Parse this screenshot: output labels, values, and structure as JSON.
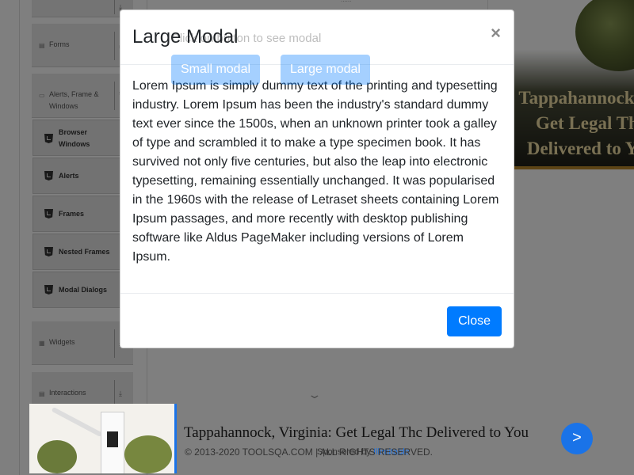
{
  "top_faint_text": "......",
  "sidebar": {
    "groups": [
      {
        "label": "Forms",
        "icon": "document-icon"
      },
      {
        "label_line1": "Alerts, Frame &",
        "label_line2": "Windows",
        "icon": "window-icon"
      },
      {
        "label": "Widgets",
        "icon": "grid-icon"
      },
      {
        "label": "Interactions",
        "icon": "document-icon"
      }
    ],
    "items": [
      {
        "label_line1": "Browser",
        "label_line2": "Windows"
      },
      {
        "label": "Alerts"
      },
      {
        "label": "Frames"
      },
      {
        "label": "Nested Frames"
      },
      {
        "label": "Modal Dialogs"
      }
    ]
  },
  "page": {
    "hint": "Click on button to see modal",
    "small_modal_label": "Small modal",
    "large_modal_label": "Large modal"
  },
  "modal": {
    "title": "Large Modal",
    "close_symbol": "×",
    "body": "Lorem Ipsum is simply dummy text of the printing and typesetting industry. Lorem Ipsum has been the industry's standard dummy text ever since the 1500s, when an unknown printer took a galley of type and scrambled it to make a type specimen book. It has survived not only five centuries, but also the leap into electronic typesetting, remaining essentially unchanged. It was popularised in the 1960s with the release of Letraset sheets containing Lorem Ipsum passages, and more recently with desktop publishing software like Aldus PageMaker including versions of Lorem Ipsum.",
    "close_button_label": "Close"
  },
  "ads": {
    "right_text": "Tappahannock, Va\nGet Legal Thc\nDelivered to You",
    "bottom_text": "Tappahannock, Virginia: Get Legal Thc Delivered to You",
    "sponsored_prefix": "Sponsored by ",
    "sponsored_brand": "Illimitable",
    "arrow": ">"
  },
  "footer": {
    "copyright": "© 2013-2020 TOOLSQA.COM | ALL RIGHTS RESERVED."
  },
  "colors": {
    "primary": "#007bff",
    "backdrop": "rgba(0,0,0,0.5)",
    "sidebar_bg": "#e9e9e9"
  }
}
